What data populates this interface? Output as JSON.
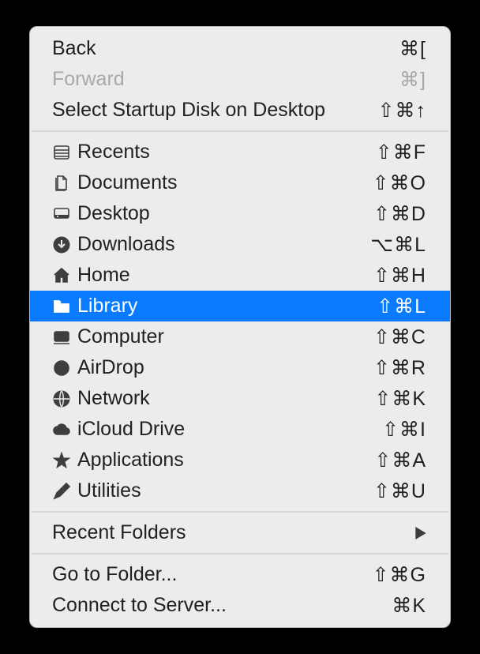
{
  "section1": [
    {
      "name": "back",
      "label": "Back",
      "shortcut": "⌘[",
      "disabled": false
    },
    {
      "name": "forward",
      "label": "Forward",
      "shortcut": "⌘]",
      "disabled": true
    },
    {
      "name": "select-startup-disk",
      "label": "Select Startup Disk on Desktop",
      "shortcut": "⇧⌘↑",
      "disabled": false
    }
  ],
  "section2": [
    {
      "name": "recents",
      "icon": "recents",
      "label": "Recents",
      "shortcut": "⇧⌘F"
    },
    {
      "name": "documents",
      "icon": "documents",
      "label": "Documents",
      "shortcut": "⇧⌘O"
    },
    {
      "name": "desktop",
      "icon": "desktop",
      "label": "Desktop",
      "shortcut": "⇧⌘D"
    },
    {
      "name": "downloads",
      "icon": "downloads",
      "label": "Downloads",
      "shortcut": "⌥⌘L"
    },
    {
      "name": "home",
      "icon": "home",
      "label": "Home",
      "shortcut": "⇧⌘H"
    },
    {
      "name": "library",
      "icon": "library",
      "label": "Library",
      "shortcut": "⇧⌘L",
      "selected": true
    },
    {
      "name": "computer",
      "icon": "computer",
      "label": "Computer",
      "shortcut": "⇧⌘C"
    },
    {
      "name": "airdrop",
      "icon": "airdrop",
      "label": "AirDrop",
      "shortcut": "⇧⌘R"
    },
    {
      "name": "network",
      "icon": "network",
      "label": "Network",
      "shortcut": "⇧⌘K"
    },
    {
      "name": "icloud-drive",
      "icon": "icloud",
      "label": "iCloud Drive",
      "shortcut": "⇧⌘I"
    },
    {
      "name": "applications",
      "icon": "applications",
      "label": "Applications",
      "shortcut": "⇧⌘A"
    },
    {
      "name": "utilities",
      "icon": "utilities",
      "label": "Utilities",
      "shortcut": "⇧⌘U"
    }
  ],
  "section3": [
    {
      "name": "recent-folders",
      "label": "Recent Folders",
      "submenu": true
    }
  ],
  "section4": [
    {
      "name": "go-to-folder",
      "label": "Go to Folder...",
      "shortcut": "⇧⌘G"
    },
    {
      "name": "connect-to-server",
      "label": "Connect to Server...",
      "shortcut": "⌘K"
    }
  ]
}
